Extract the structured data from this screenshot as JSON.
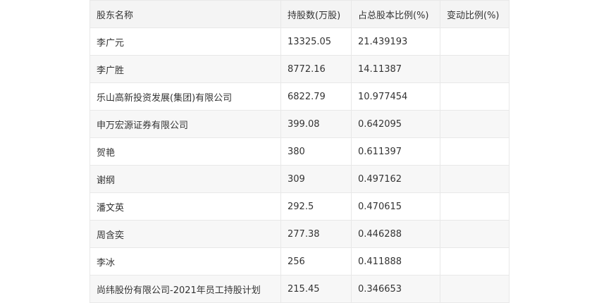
{
  "table": {
    "headers": [
      "股东名称",
      "持股数(万股)",
      "占总股本比例(%)",
      "变动比例(%)"
    ],
    "rows": [
      {
        "name": "李广元",
        "shares": "13325.05",
        "ratio": "21.439193",
        "change": ""
      },
      {
        "name": "李广胜",
        "shares": "8772.16",
        "ratio": "14.11387",
        "change": ""
      },
      {
        "name": "乐山高新投资发展(集团)有限公司",
        "shares": "6822.79",
        "ratio": "10.977454",
        "change": ""
      },
      {
        "name": "申万宏源证券有限公司",
        "shares": "399.08",
        "ratio": "0.642095",
        "change": ""
      },
      {
        "name": "贺艳",
        "shares": "380",
        "ratio": "0.611397",
        "change": ""
      },
      {
        "name": "谢纲",
        "shares": "309",
        "ratio": "0.497162",
        "change": ""
      },
      {
        "name": "潘文英",
        "shares": "292.5",
        "ratio": "0.470615",
        "change": ""
      },
      {
        "name": "周含奕",
        "shares": "277.38",
        "ratio": "0.446288",
        "change": ""
      },
      {
        "name": "李冰",
        "shares": "256",
        "ratio": "0.411888",
        "change": ""
      },
      {
        "name": "尚纬股份有限公司-2021年员工持股计划",
        "shares": "215.45",
        "ratio": "0.346653",
        "change": ""
      }
    ]
  }
}
